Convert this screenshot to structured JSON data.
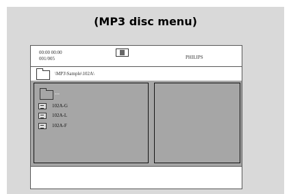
{
  "caption": "(MP3 disc menu)",
  "status": {
    "time": "00:00   00:00",
    "track": "001/005",
    "brand": "PHILIPS"
  },
  "path": "\\MP3\\Sample\\102A\\",
  "list": {
    "parent": "---",
    "files": [
      "102A-G",
      "102A-L",
      "102A-F"
    ]
  }
}
